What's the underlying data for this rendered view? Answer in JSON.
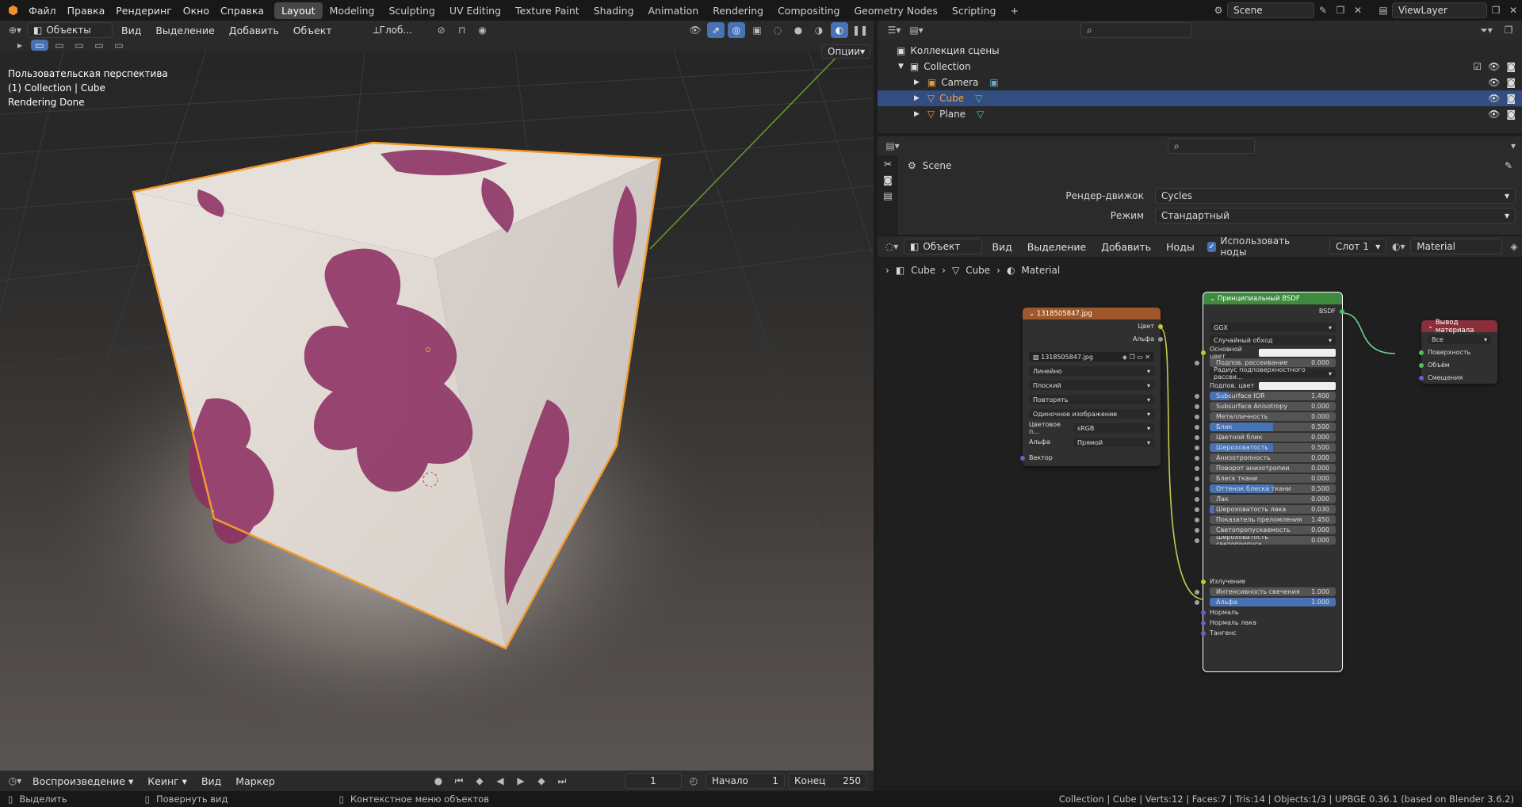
{
  "topbar": {
    "menus": [
      "Файл",
      "Правка",
      "Рендеринг",
      "Окно",
      "Справка"
    ],
    "tabs": [
      "Layout",
      "Modeling",
      "Sculpting",
      "UV Editing",
      "Texture Paint",
      "Shading",
      "Animation",
      "Rendering",
      "Compositing",
      "Geometry Nodes",
      "Scripting"
    ],
    "scene": "Scene",
    "viewlayer": "ViewLayer",
    "add_tab": "+"
  },
  "vp_header": {
    "mode": "Объекты",
    "menus": [
      "Вид",
      "Выделение",
      "Добавить",
      "Объект"
    ],
    "orientation": "Глоб...",
    "options": "Опции"
  },
  "vp_overlay": {
    "line1": "Пользовательская перспектива",
    "line2": "(1) Collection | Cube",
    "line3": "Rendering Done"
  },
  "outliner": {
    "root": "Коллекция сцены",
    "collection": "Collection",
    "items": [
      "Camera",
      "Cube",
      "Plane"
    ]
  },
  "props": {
    "scene": "Scene",
    "engine_label": "Рендер-движок",
    "engine": "Cycles",
    "mode_label": "Режим",
    "mode": "Стандартный"
  },
  "node_header": {
    "type": "Объект",
    "menus": [
      "Вид",
      "Выделение",
      "Добавить",
      "Ноды"
    ],
    "use_nodes": "Использовать ноды",
    "slot": "Слот 1",
    "material": "Material"
  },
  "breadcrumb": [
    "Cube",
    "Cube",
    "Material"
  ],
  "img_node": {
    "title": "1318505847.jpg",
    "out_color": "Цвет",
    "out_alpha": "Альфа",
    "file": "1318505847.jpg",
    "interp": "Линейно",
    "proj": "Плоский",
    "ext": "Повторять",
    "src": "Одиночное изображение",
    "cs_label": "Цветовое п...",
    "cs": "sRGB",
    "alpha_label": "Альфа",
    "alpha": "Прямой",
    "vector": "Вектор"
  },
  "bsdf": {
    "title": "Принципиальный BSDF",
    "out": "BSDF",
    "dist": "GGX",
    "sss": "Случайный обход",
    "base_color": "Основной цвет",
    "sub_color": "Подпов. цвет",
    "sliders": [
      {
        "label": "Подпов. рассеивание",
        "value": "0.000",
        "fill": 0
      },
      {
        "label": "Subsurface IOR",
        "value": "1.400",
        "fill": 0.15
      },
      {
        "label": "Subsurface Anisotropy",
        "value": "0.000",
        "fill": 0
      },
      {
        "label": "Металличность",
        "value": "0.000",
        "fill": 0
      },
      {
        "label": "Блик",
        "value": "0.500",
        "fill": 0.5
      },
      {
        "label": "Цветной блик",
        "value": "0.000",
        "fill": 0
      },
      {
        "label": "Шероховатость",
        "value": "0.500",
        "fill": 0.5
      },
      {
        "label": "Анизотропность",
        "value": "0.000",
        "fill": 0
      },
      {
        "label": "Поворот анизотропии",
        "value": "0.000",
        "fill": 0
      },
      {
        "label": "Блеск ткани",
        "value": "0.000",
        "fill": 0
      },
      {
        "label": "Оттенок блеска ткани",
        "value": "0.500",
        "fill": 0.5
      },
      {
        "label": "Лак",
        "value": "0.000",
        "fill": 0
      },
      {
        "label": "Шероховатость лака",
        "value": "0.030",
        "fill": 0.03
      },
      {
        "label": "Показатель преломления",
        "value": "1.450",
        "fill": 0
      },
      {
        "label": "Светопропускаемость",
        "value": "0.000",
        "fill": 0
      },
      {
        "label": "Шероховатость светопропуск",
        "value": "0.000",
        "fill": 0
      }
    ],
    "radius": "Радиус подповерхностного рассеи...",
    "emission": "Излучение",
    "sliders2": [
      {
        "label": "Интенсивность свечения",
        "value": "1.000",
        "fill": 0
      },
      {
        "label": "Альфа",
        "value": "1.000",
        "fill": 1
      }
    ],
    "normal": "Нормаль",
    "clearcoat_normal": "Нормаль лака",
    "tangent": "Тангенс"
  },
  "output": {
    "title": "Вывод материала",
    "target": "Все",
    "surface": "Поверхность",
    "volume": "Объём",
    "displacement": "Смещения"
  },
  "timeline": {
    "playback": "Воспроизведение",
    "keying": "Кеинг",
    "view": "Вид",
    "marker": "Маркер",
    "frame": "1",
    "start_label": "Начало",
    "start": "1",
    "end_label": "Конец",
    "end": "250"
  },
  "status": {
    "select": "Выделить",
    "rotate": "Повернуть вид",
    "context": "Контекстное меню объектов",
    "info": "Collection | Cube | Verts:12 | Faces:7 | Tris:14 | Objects:1/3 | UPBGE 0.36.1 (based on Blender 3.6.2)"
  }
}
